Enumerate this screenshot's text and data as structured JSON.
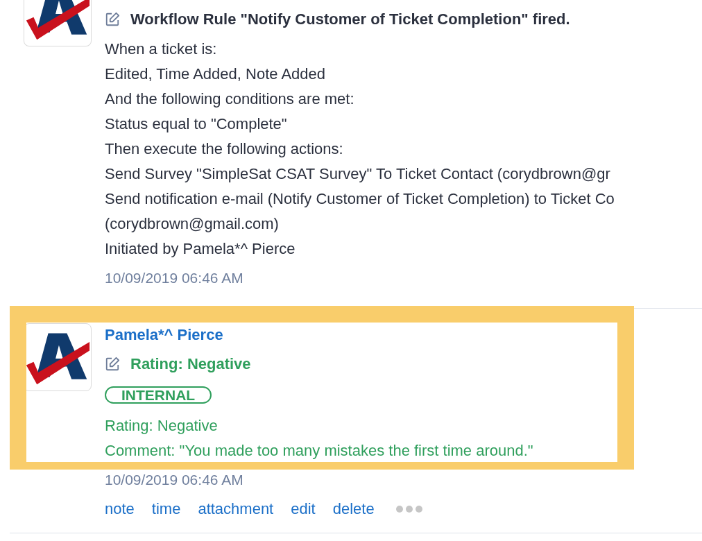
{
  "entries": [
    {
      "kind": "workflow",
      "title": "Workflow Rule \"Notify Customer of Ticket Completion\" fired.",
      "lines": [
        "When a ticket is:",
        "Edited, Time Added, Note Added",
        "And the following conditions are met:",
        "Status equal to \"Complete\"",
        "Then execute the following actions:",
        "Send Survey \"SimpleSat CSAT Survey\" To Ticket Contact (corydbrown@gr",
        "Send notification e-mail (Notify Customer of Ticket Completion) to Ticket Co",
        "(corydbrown@gmail.com)",
        "Initiated by Pamela*^ Pierce"
      ],
      "timestamp": "10/09/2019 06:46 AM"
    },
    {
      "kind": "rating",
      "author": "Pamela*^ Pierce",
      "title": "Rating: Negative",
      "badge": "INTERNAL",
      "lines": [
        "Rating: Negative",
        "Comment: \"You made too many mistakes the first time around.\""
      ],
      "timestamp": "10/09/2019 06:46 AM",
      "actions": [
        "note",
        "time",
        "attachment",
        "edit",
        "delete"
      ],
      "highlighted": true
    }
  ]
}
